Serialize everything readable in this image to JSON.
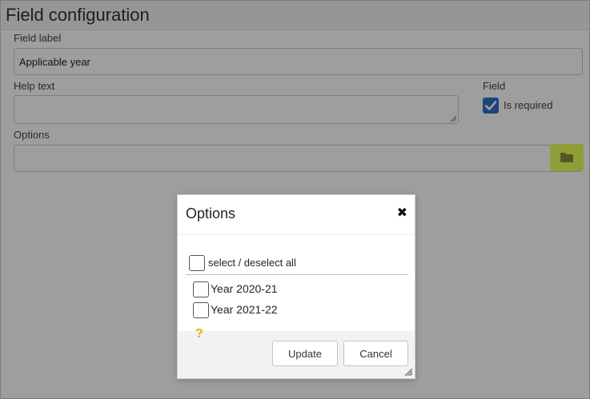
{
  "page": {
    "title": "Field configuration"
  },
  "form": {
    "field_label": {
      "label": "Field label",
      "value": "Applicable year"
    },
    "help_text": {
      "label": "Help text",
      "value": ""
    },
    "field_section": {
      "label": "Field",
      "required_label": "Is required",
      "required_checked": true
    },
    "options": {
      "label": "Options",
      "value": ""
    }
  },
  "modal": {
    "title": "Options",
    "close_icon": "close-icon",
    "select_all_label": "select / deselect all",
    "items": [
      {
        "label": "Year 2020-21",
        "checked": false
      },
      {
        "label": "Year 2021-22",
        "checked": false
      }
    ],
    "help_mark": "?",
    "update_label": "Update",
    "cancel_label": "Cancel"
  },
  "colors": {
    "accent_checkbox": "#2f6ecb",
    "folder_highlight": "#e9ff5c",
    "help_mark": "#f0a800"
  }
}
